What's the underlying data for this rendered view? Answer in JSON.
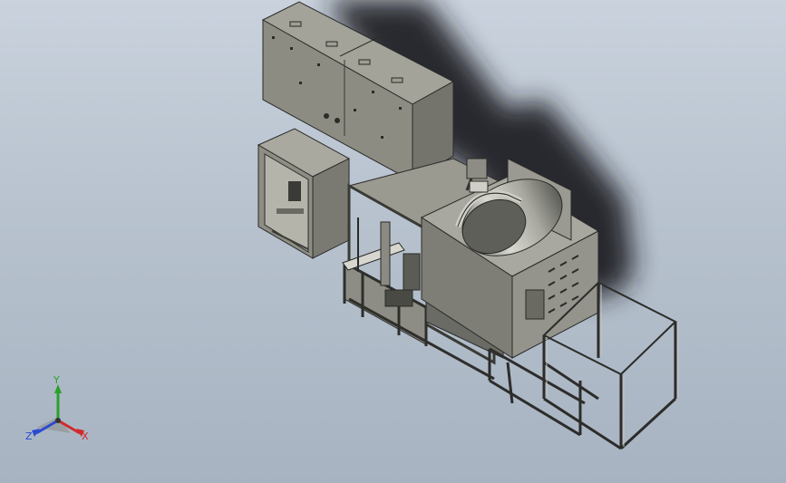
{
  "viewport": {
    "background_top": "#c9d2dd",
    "background_bottom": "#a7b3c1"
  },
  "model": {
    "panel_color": "#8f8f86",
    "panel_dark": "#6d6d66",
    "frame_color": "#a8a8a0",
    "metal_light": "#c8c8c0",
    "shadow_color": "#1e1e22"
  },
  "triad": {
    "x_label": "X",
    "y_label": "Y",
    "z_label": "Z",
    "x_color": "#d12a2a",
    "y_color": "#2aa12a",
    "z_color": "#2a4ad1"
  }
}
